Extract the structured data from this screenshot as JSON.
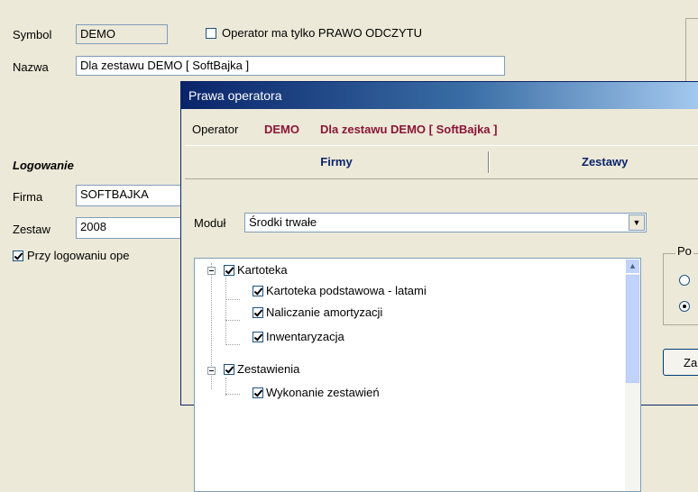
{
  "form": {
    "symbol_label": "Symbol",
    "symbol_value": "DEMO",
    "readonly_checkbox_label": "Operator ma tylko PRAWO ODCZYTU",
    "readonly_checked": false,
    "name_label": "Nazwa",
    "name_value": "Dla zestawu DEMO [ SoftBajka ]",
    "login_heading": "Logowanie",
    "company_label": "Firma",
    "company_value": "SOFTBAJKA",
    "set_label": "Zestaw",
    "set_value": "2008",
    "login_checkbox_label": "Przy logowaniu ope",
    "login_checkbox_checked": true
  },
  "dialog": {
    "title": "Prawa operatora",
    "operator_label": "Operator",
    "operator_symbol": "DEMO",
    "operator_name": "Dla zestawu DEMO [ SoftBajka ]",
    "tabs": [
      {
        "label": "Firmy"
      },
      {
        "label": "Zestawy"
      }
    ],
    "module_label": "Moduł",
    "module_value": "Środki trwałe",
    "tree": [
      {
        "label": "Kartoteka",
        "checked": true
      },
      {
        "label": "Kartoteka podstawowa - latami",
        "checked": true
      },
      {
        "label": "Naliczanie amortyzacji",
        "checked": true
      },
      {
        "label": "Inwentaryzacja",
        "checked": true
      },
      {
        "label": "Zestawienia",
        "checked": true
      },
      {
        "label": "Wykonanie zestawień",
        "checked": true
      }
    ],
    "right_group_label": "Po",
    "right_button_label": "Za"
  }
}
